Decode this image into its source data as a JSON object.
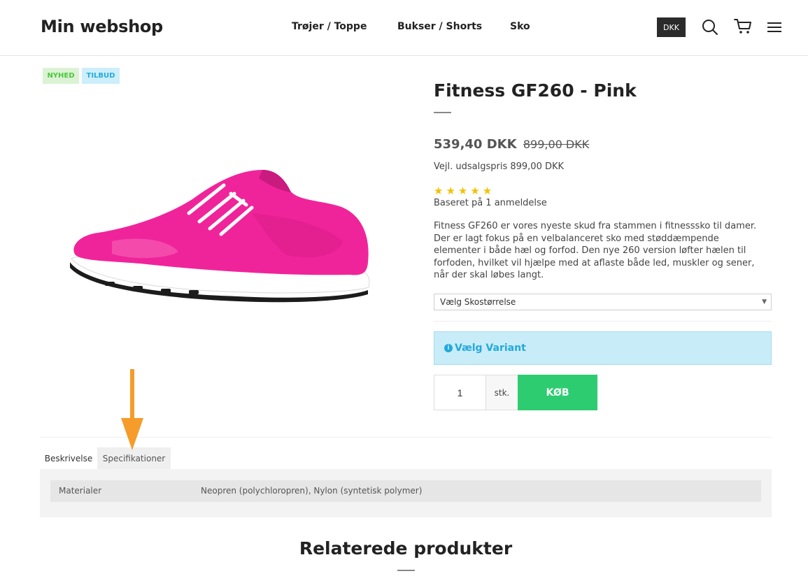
{
  "header": {
    "logo": "Min webshop",
    "nav": [
      "Trøjer / Toppe",
      "Bukser / Shorts",
      "Sko"
    ],
    "currency": "DKK",
    "icons": [
      "search-icon",
      "cart-icon",
      "menu-icon"
    ]
  },
  "badges": {
    "new": "NYHED",
    "sale": "TILBUD"
  },
  "product": {
    "title": "Fitness GF260 - Pink",
    "price": "539,40 DKK",
    "price_old": "899,00 DKK",
    "rrp": "Vejl. udsalgspris 899,00 DKK",
    "rating": 5,
    "stars": "★★★★★",
    "reviews": "Baseret på 1 anmeldelse",
    "description": "Fitness GF260 er vores nyeste skud fra stammen i fitnesssko til damer. Der er lagt fokus på en velbalanceret sko med støddæmpende elementer i både hæl og forfod. Den nye 260 version løfter hælen til forfoden, hvilket vil hjælpe med at aflaste både led, muskler og sener, når der skal løbes langt.",
    "size_select": "Vælg Skostørrelse",
    "variant_alert": "Vælg Variant",
    "quantity": "1",
    "unit": "stk.",
    "buy_label": "KØB"
  },
  "tabs": {
    "description": "Beskrivelse",
    "specifications": "Specifikationer"
  },
  "specs": [
    {
      "key": "Materialer",
      "value": "Neopren (polychloropren), Nylon (syntetisk polymer)"
    }
  ],
  "related_title": "Relaterede produkter",
  "colors": {
    "buy": "#2ecc71",
    "alert_bg": "#c8ecf8",
    "alert_text": "#23a9db",
    "badge_new": "#4cc73d",
    "badge_sale": "#27a9dd",
    "shoe": "#f0249a",
    "arrow": "#f59c2a"
  }
}
